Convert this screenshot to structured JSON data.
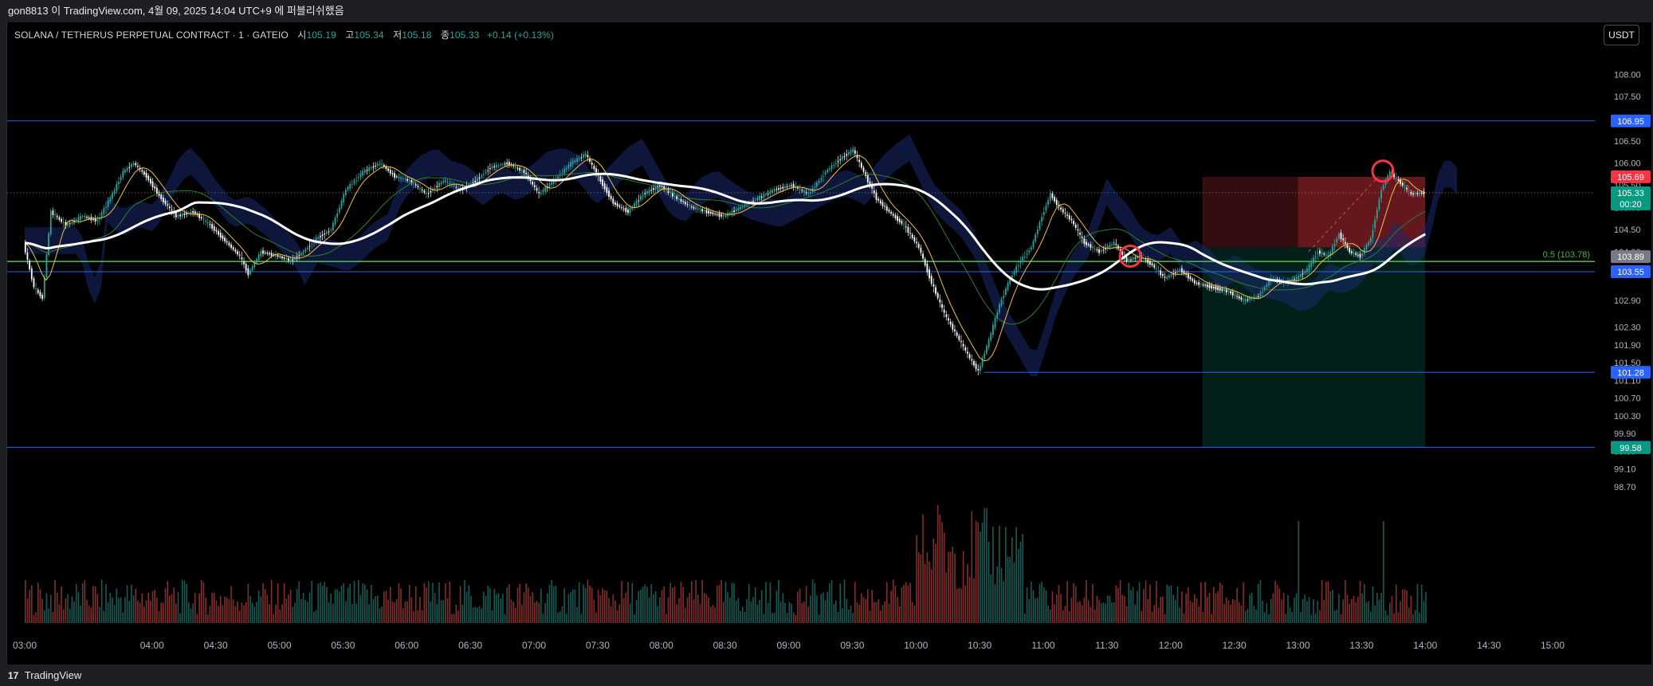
{
  "header": {
    "attribution": "gon8813 이 TradingView.com, 4월 09, 2025 14:04 UTC+9 에 퍼블리쉬했음"
  },
  "legend": {
    "symbol": "SOLANA / TETHERUS PERPETUAL CONTRACT · 1 · GATEIO",
    "open_label": "시",
    "open": "105.19",
    "high_label": "고",
    "high": "105.34",
    "low_label": "저",
    "low": "105.18",
    "close_label": "종",
    "close": "105.33",
    "change": "+0.14 (+0.13%)"
  },
  "currency_button": "USDT",
  "footer": {
    "logo": "17",
    "brand": "TradingView"
  },
  "colors": {
    "up": "#26a69a",
    "down": "#ef5350",
    "blue_line": "#2962ff",
    "green_line": "#4caf50",
    "ma_white": "#ffffff",
    "stop_zone": "#f23645",
    "target_zone": "#089981",
    "cloud": "#1a2a6c"
  },
  "chart_data": {
    "type": "candlestick",
    "interval": "1m",
    "x_ticks": [
      "03:00",
      "04:00",
      "04:30",
      "05:00",
      "05:30",
      "06:00",
      "06:30",
      "07:00",
      "07:30",
      "08:00",
      "08:30",
      "09:00",
      "09:30",
      "10:00",
      "10:30",
      "11:00",
      "11:30",
      "12:00",
      "12:30",
      "13:00",
      "13:30",
      "14:00",
      "14:30",
      "15:00"
    ],
    "y_ticks": [
      "108.00",
      "107.50",
      "106.50",
      "106.00",
      "105.50",
      "105.00",
      "104.50",
      "104.00",
      "102.90",
      "102.30",
      "101.90",
      "101.50",
      "101.10",
      "100.70",
      "100.30",
      "99.90",
      "99.50",
      "99.10",
      "98.70"
    ],
    "y_range": [
      98.5,
      108.6
    ],
    "price_levels": [
      {
        "label": "106.95",
        "value": 106.95,
        "color": "#2962ff"
      },
      {
        "label": "103.55",
        "value": 103.55,
        "color": "#2962ff"
      },
      {
        "label": "101.28",
        "value": 101.28,
        "color": "#2962ff"
      },
      {
        "label": "99.59",
        "value": 99.59,
        "color": "#2962ff"
      }
    ],
    "fib_level": {
      "label": "0.5 (103.78)",
      "value": 103.78,
      "color": "#4caf50"
    },
    "axis_badges": [
      {
        "label": "105.69",
        "value": 105.69,
        "color": "#f23645"
      },
      {
        "label": "105.33",
        "sub": "00:20",
        "value": 105.33,
        "color": "#089981"
      },
      {
        "label": "103.89",
        "value": 103.89,
        "color": "#787b86"
      },
      {
        "label": "99.58",
        "value": 99.58,
        "color": "#089981"
      }
    ],
    "position_tool": {
      "entry": 104.1,
      "stop": 105.69,
      "target": 99.58,
      "start_time": "12:15",
      "end_time": "14:00",
      "inner_start": "13:00"
    },
    "markers": [
      {
        "time": "11:41",
        "price": 103.9
      },
      {
        "time": "13:40",
        "price": 105.82
      }
    ],
    "series_main": [
      [
        "03:00",
        104.2
      ],
      [
        "03:05",
        103.2
      ],
      [
        "03:09",
        102.95
      ],
      [
        "03:13",
        104.9
      ],
      [
        "03:20",
        104.6
      ],
      [
        "03:28",
        104.8
      ],
      [
        "03:35",
        104.7
      ],
      [
        "03:42",
        105.3
      ],
      [
        "03:47",
        105.8
      ],
      [
        "03:52",
        106.0
      ],
      [
        "03:58",
        105.7
      ],
      [
        "04:05",
        105.2
      ],
      [
        "04:12",
        104.8
      ],
      [
        "04:20",
        104.9
      ],
      [
        "04:28",
        104.6
      ],
      [
        "04:36",
        104.2
      ],
      [
        "04:42",
        103.9
      ],
      [
        "04:46",
        103.5
      ],
      [
        "04:52",
        104.0
      ],
      [
        "05:00",
        103.9
      ],
      [
        "05:06",
        103.8
      ],
      [
        "05:12",
        104.0
      ],
      [
        "05:18",
        104.3
      ],
      [
        "05:25",
        104.5
      ],
      [
        "05:32",
        105.4
      ],
      [
        "05:40",
        105.8
      ],
      [
        "05:48",
        106.0
      ],
      [
        "05:55",
        105.7
      ],
      [
        "06:02",
        105.6
      ],
      [
        "06:10",
        105.3
      ],
      [
        "06:18",
        105.6
      ],
      [
        "06:26",
        105.4
      ],
      [
        "06:33",
        105.6
      ],
      [
        "06:40",
        105.9
      ],
      [
        "06:48",
        106.0
      ],
      [
        "06:56",
        105.8
      ],
      [
        "07:03",
        105.3
      ],
      [
        "07:10",
        105.6
      ],
      [
        "07:18",
        106.0
      ],
      [
        "07:25",
        106.2
      ],
      [
        "07:32",
        105.6
      ],
      [
        "07:38",
        105.1
      ],
      [
        "07:45",
        104.9
      ],
      [
        "07:52",
        105.3
      ],
      [
        "08:00",
        105.5
      ],
      [
        "08:08",
        105.2
      ],
      [
        "08:15",
        105.0
      ],
      [
        "08:22",
        104.9
      ],
      [
        "08:30",
        104.8
      ],
      [
        "08:38",
        105.0
      ],
      [
        "08:46",
        105.2
      ],
      [
        "08:54",
        105.4
      ],
      [
        "09:02",
        105.5
      ],
      [
        "09:10",
        105.3
      ],
      [
        "09:18",
        105.8
      ],
      [
        "09:25",
        106.1
      ],
      [
        "09:31",
        106.3
      ],
      [
        "09:36",
        105.8
      ],
      [
        "09:42",
        105.2
      ],
      [
        "09:48",
        104.9
      ],
      [
        "09:55",
        104.6
      ],
      [
        "10:02",
        104.1
      ],
      [
        "10:08",
        103.3
      ],
      [
        "10:14",
        102.6
      ],
      [
        "10:20",
        102.1
      ],
      [
        "10:26",
        101.6
      ],
      [
        "10:30",
        101.3
      ],
      [
        "10:35",
        102.0
      ],
      [
        "10:40",
        102.8
      ],
      [
        "10:45",
        103.4
      ],
      [
        "10:50",
        103.8
      ],
      [
        "10:55",
        104.1
      ],
      [
        "11:00",
        104.8
      ],
      [
        "11:04",
        105.3
      ],
      [
        "11:08",
        105.0
      ],
      [
        "11:14",
        104.7
      ],
      [
        "11:20",
        104.2
      ],
      [
        "11:27",
        104.0
      ],
      [
        "11:34",
        104.2
      ],
      [
        "11:40",
        103.8
      ],
      [
        "11:46",
        103.9
      ],
      [
        "11:52",
        103.7
      ],
      [
        "11:58",
        103.4
      ],
      [
        "12:05",
        103.6
      ],
      [
        "12:12",
        103.3
      ],
      [
        "12:20",
        103.2
      ],
      [
        "12:28",
        103.1
      ],
      [
        "12:35",
        102.9
      ],
      [
        "12:42",
        103.0
      ],
      [
        "12:48",
        103.4
      ],
      [
        "12:54",
        103.3
      ],
      [
        "13:00",
        103.4
      ],
      [
        "13:05",
        103.6
      ],
      [
        "13:10",
        104.0
      ],
      [
        "13:15",
        103.9
      ],
      [
        "13:20",
        104.4
      ],
      [
        "13:25",
        104.0
      ],
      [
        "13:30",
        103.9
      ],
      [
        "13:35",
        104.3
      ],
      [
        "13:40",
        105.4
      ],
      [
        "13:44",
        105.8
      ],
      [
        "13:48",
        105.6
      ],
      [
        "13:54",
        105.3
      ],
      [
        "14:00",
        105.33
      ]
    ]
  }
}
